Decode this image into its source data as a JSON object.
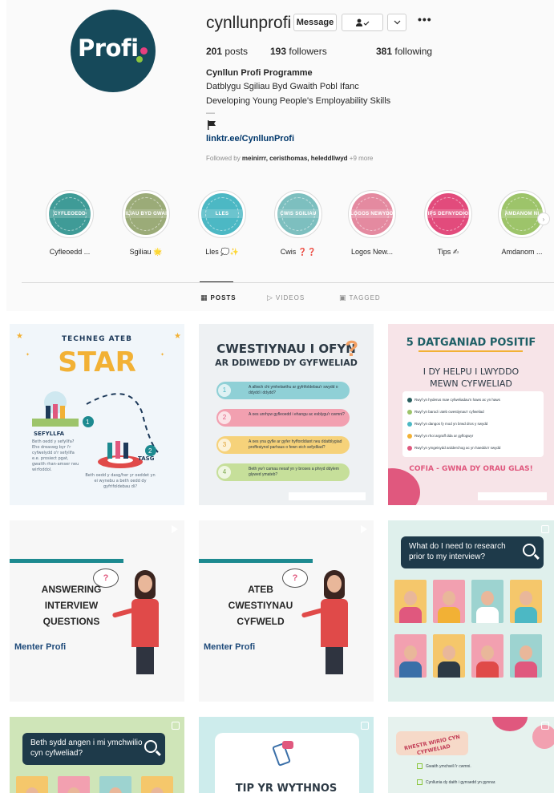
{
  "profile": {
    "username": "cynllunprofi",
    "avatar_text": "Profi",
    "buttons": {
      "message": "Message",
      "follow_icon": "👤✓",
      "chevron_icon": "⌄",
      "more_icon": "•••"
    },
    "stats": {
      "posts_count": "201",
      "posts_label": "posts",
      "followers_count": "193",
      "followers_label": "followers",
      "following_count": "381",
      "following_label": "following"
    },
    "bio": {
      "name": "Cynllun Profi Programme",
      "line1": "Datblygu Sgiliau Byd Gwaith Pobl Ifanc",
      "line2": "Developing Young People's Employability Skills",
      "dash": "—",
      "link": "linktr.ee/CynllunProfi"
    },
    "followed_by": {
      "prefix": "Followed by",
      "names": "meinirrr, ceristhomas, heleddllwyd",
      "more": "+9 more"
    }
  },
  "highlights": [
    {
      "label": "Cyfleoedd ...",
      "badge": "CYFLEOEDD",
      "color": "#3f9b97"
    },
    {
      "label": "Sgiliau 🌟",
      "badge": "SGILIAU BYD GWAITH",
      "color": "#9bab78"
    },
    {
      "label": "Lles 💭✨",
      "badge": "LLES",
      "color": "#4cb8c4"
    },
    {
      "label": "Cwis ❓❓",
      "badge": "CWIS SGILIAU",
      "color": "#7dbfbf"
    },
    {
      "label": "Logos New...",
      "badge": "LOGOS NEWYDD",
      "color": "#e48aa0"
    },
    {
      "label": "Tips ✍",
      "badge": "TIPS DEFNYDDIOL",
      "color": "#e24b7c"
    },
    {
      "label": "Amdanom ...",
      "badge": "AMDANOM NI",
      "color": "#9dc46a"
    }
  ],
  "tabs": [
    {
      "label": "POSTS",
      "icon": "▦"
    },
    {
      "label": "VIDEOS",
      "icon": "▷"
    },
    {
      "label": "TAGGED",
      "icon": "▣"
    }
  ],
  "posts": {
    "p1": {
      "title_small": "TECHNEG ATEB",
      "title_big": "STAR",
      "step1": "SEFYLLFA",
      "step1_text": "Beth oedd y sefyllfa? Eho dreaswg byr i'r cyfwelydd o'r sefyllfa e.e. prosiect pgat, gwaith rhan-amser neu wirfoddol.",
      "step2": "TASG",
      "step2_text": "Beth oedd y dasg/her yr oeddet yn ei wynebu a beth oedd dy gyfrifoldebau di?"
    },
    "p2": {
      "title1": "CWESTIYNAU I OFYN",
      "title2": "AR DDIWEDD DY GYFWELIAD",
      "questions": [
        {
          "n": "1",
          "text": "A allwch chi ymhelaethu ar gyfrifoldebau'r swydd o ddydd i ddydd?",
          "color": "#8fd0d6"
        },
        {
          "n": "2",
          "text": "A oes unrhyw gyfleoedd i ehangu ac esblygu'r cwmni?",
          "color": "#f2a0b0"
        },
        {
          "n": "3",
          "text": "A oes yna gyfle ar gyfer hyfforddiant neu ddatblygiad proffesiynol parhaus o fewn eich sefydliad?",
          "color": "#f6d27a"
        },
        {
          "n": "4",
          "text": "Beth yw'r camau nesaf yn y broses a phryd ddylem glywed ymateb?",
          "color": "#c6df9a"
        }
      ]
    },
    "p3": {
      "title": "5 DATGANIAD POSITIF",
      "subtitle1": "I DY HELPU I LWYDDO",
      "subtitle2": "MEWN CYFWELIAD",
      "rows": [
        {
          "text": "Rwyf yn hyderus mae cyfweliadau'n haws ac yn haws",
          "color": "#2a5f5f"
        },
        {
          "text": "Rwyf yn barod i ateb cwestiynau'r cyfweliad",
          "color": "#9dc46a"
        },
        {
          "text": "Rwyf yn dangos fy mod yn brwd dros y swydd",
          "color": "#4cb8c4"
        },
        {
          "text": "Rwyf yn rhoi argraff dda ar gyflogwyr",
          "color": "#f2b135"
        },
        {
          "text": "Rwyf yn ymgeisydd ardderchog ac yn haeddu'r swydd",
          "color": "#e0587e"
        }
      ],
      "footer": "COFIA - GWNA DY ORAU GLAS!"
    },
    "p4": {
      "line1": "ANSWERING",
      "line2": "INTERVIEW",
      "line3": "QUESTIONS",
      "bubble": "?",
      "logo": "Menter Profi"
    },
    "p5": {
      "line1": "ATEB",
      "line2": "CWESTIYNAU",
      "line3": "CYFWELD",
      "bubble": "?",
      "logo": "Menter Profi"
    },
    "p6": {
      "banner": "What do I need to research prior to my interview?"
    },
    "p7": {
      "banner": "Beth sydd angen i mi ymchwilio cyn cyfweliad?"
    },
    "p8": {
      "title": "TIP YR WYTHNOS"
    },
    "p9": {
      "title": "RHESTR WIRIO CYN CYFWELIAD",
      "rows": [
        "Gwaith ymchwil i'r cwmni.",
        "Cynllunia dy daith i gyrraedd yn gynnar."
      ]
    }
  },
  "colors": {
    "avatar_bg": "#16495a",
    "link": "#00376b",
    "muted": "#8e8e8e"
  }
}
